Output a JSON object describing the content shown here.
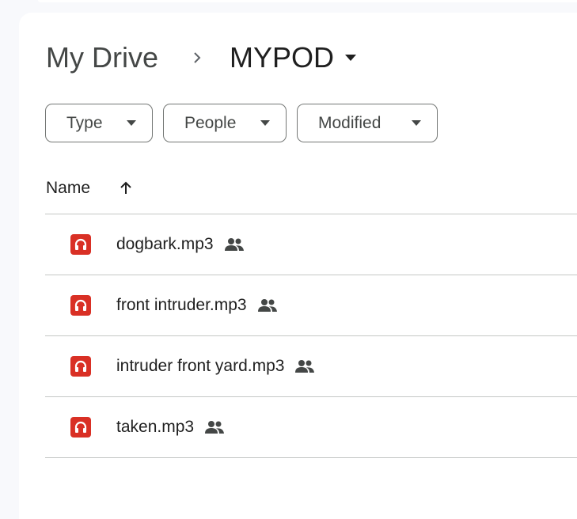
{
  "breadcrumb": {
    "root": "My Drive",
    "current": "MYPOD"
  },
  "filters": [
    {
      "label": "Type"
    },
    {
      "label": "People"
    },
    {
      "label": "Modified"
    }
  ],
  "list": {
    "name_header": "Name",
    "sort": "ascending",
    "files": [
      {
        "name": "dogbark.mp3",
        "shared": true,
        "icon": "audio-file-icon"
      },
      {
        "name": "front intruder.mp3",
        "shared": true,
        "icon": "audio-file-icon"
      },
      {
        "name": "intruder front yard.mp3",
        "shared": true,
        "icon": "audio-file-icon"
      },
      {
        "name": "taken.mp3",
        "shared": true,
        "icon": "audio-file-icon"
      }
    ]
  },
  "colors": {
    "audio_icon": "#d93025",
    "divider": "#c4c7c5",
    "chip_border": "#747775"
  }
}
